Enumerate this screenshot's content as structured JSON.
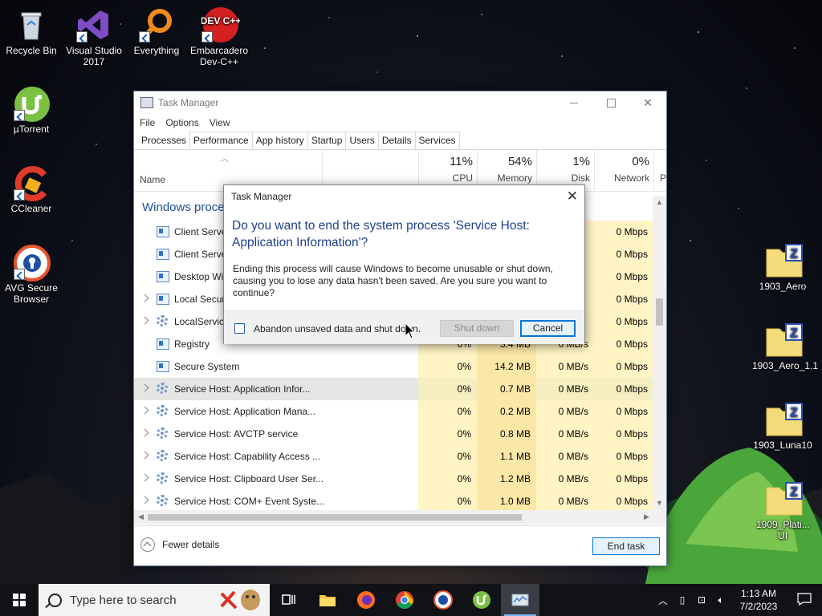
{
  "desktop": {
    "icons": [
      {
        "label": "Recycle Bin"
      },
      {
        "label": "Visual Studio 2017"
      },
      {
        "label": "Everything"
      },
      {
        "label": "Embarcadero Dev-C++"
      },
      {
        "label": "µTorrent"
      },
      {
        "label": "CCleaner"
      },
      {
        "label": "AVG Secure Browser"
      },
      {
        "label": "1903_Aero"
      },
      {
        "label": "1903_Aero_1.1"
      },
      {
        "label": "1903_Luna10"
      },
      {
        "label": "1909_Plati... UI"
      }
    ],
    "dev_icon_text": "DEV C++"
  },
  "taskmgr": {
    "title": "Task Manager",
    "menu": [
      "File",
      "Options",
      "View"
    ],
    "tabs": [
      "Processes",
      "Performance",
      "App history",
      "Startup",
      "Users",
      "Details",
      "Services"
    ],
    "active_tab": "Processes",
    "columns": {
      "name": "Name",
      "cpu_pct": "11%",
      "cpu": "CPU",
      "mem_pct": "54%",
      "mem": "Memory",
      "disk_pct": "1%",
      "disk": "Disk",
      "net_pct": "0%",
      "net": "Network",
      "extra": "P"
    },
    "group": "Windows processes",
    "rows": [
      {
        "name": "Client Server Runtime Process",
        "cpu": "",
        "mem": "",
        "disk": "",
        "net": "0 Mbps",
        "icon": "process",
        "expand": false
      },
      {
        "name": "Client Server Runtime Process",
        "cpu": "",
        "mem": "",
        "disk": "",
        "net": "0 Mbps",
        "icon": "process",
        "expand": false
      },
      {
        "name": "Desktop Window Manager",
        "cpu": "",
        "mem": "",
        "disk": "",
        "net": "0 Mbps",
        "icon": "process",
        "expand": false
      },
      {
        "name": "Local Security Authority Process",
        "cpu": "",
        "mem": "",
        "disk": "",
        "net": "0 Mbps",
        "icon": "process",
        "expand": true
      },
      {
        "name": "LocalServiceNoNetworkFirewall",
        "cpu": "",
        "mem": "",
        "disk": "",
        "net": "0 Mbps",
        "icon": "gear",
        "expand": true
      },
      {
        "name": "Registry",
        "cpu": "0%",
        "mem": "3.4 MB",
        "disk": "0 MB/s",
        "net": "0 Mbps",
        "icon": "process",
        "expand": false
      },
      {
        "name": "Secure System",
        "cpu": "0%",
        "mem": "14.2 MB",
        "disk": "0 MB/s",
        "net": "0 Mbps",
        "icon": "process",
        "expand": false
      },
      {
        "name": "Service Host: Application Infor...",
        "cpu": "0%",
        "mem": "0.7 MB",
        "disk": "0 MB/s",
        "net": "0 Mbps",
        "icon": "gear",
        "expand": true,
        "selected": true
      },
      {
        "name": "Service Host: Application Mana...",
        "cpu": "0%",
        "mem": "0.2 MB",
        "disk": "0 MB/s",
        "net": "0 Mbps",
        "icon": "gear",
        "expand": true
      },
      {
        "name": "Service Host: AVCTP service",
        "cpu": "0%",
        "mem": "0.8 MB",
        "disk": "0 MB/s",
        "net": "0 Mbps",
        "icon": "gear",
        "expand": true
      },
      {
        "name": "Service Host: Capability Access ...",
        "cpu": "0%",
        "mem": "1.1 MB",
        "disk": "0 MB/s",
        "net": "0 Mbps",
        "icon": "gear",
        "expand": true
      },
      {
        "name": "Service Host: Clipboard User Ser...",
        "cpu": "0%",
        "mem": "1.2 MB",
        "disk": "0 MB/s",
        "net": "0 Mbps",
        "icon": "gear",
        "expand": true
      },
      {
        "name": "Service Host: COM+ Event Syste...",
        "cpu": "0%",
        "mem": "1.0 MB",
        "disk": "0 MB/s",
        "net": "0 Mbps",
        "icon": "gear",
        "expand": true
      }
    ],
    "fewer_details": "Fewer details",
    "end_task": "End task"
  },
  "dialog": {
    "title": "Task Manager",
    "main": "Do you want to end the system process 'Service Host: Application Information'?",
    "body": "Ending this process will cause Windows to become unusable or shut down, causing you to lose any data hasn't been saved. Are you sure you want to continue?",
    "checkbox_label": "Abandon unsaved data and shut down.",
    "shutdown_label": "Shut down",
    "cancel_label": "Cancel"
  },
  "taskbar": {
    "search_placeholder": "Type here to search",
    "time": "1:13 AM",
    "date": "7/2/2023",
    "apps": [
      "task-view-icon",
      "file-explorer-icon",
      "firefox-icon",
      "chrome-icon",
      "avg-browser-icon",
      "utorrent-icon",
      "task-manager-icon"
    ]
  }
}
